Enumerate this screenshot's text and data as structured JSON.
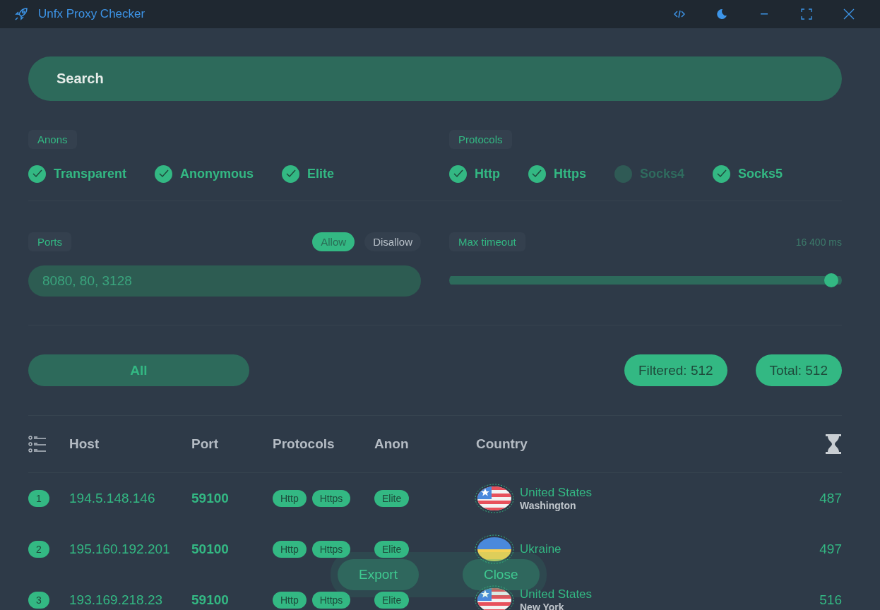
{
  "window": {
    "title": "Unfx Proxy Checker"
  },
  "search": {
    "placeholder": "Search"
  },
  "anons": {
    "label": "Anons",
    "items": [
      {
        "label": "Transparent",
        "checked": true
      },
      {
        "label": "Anonymous",
        "checked": true
      },
      {
        "label": "Elite",
        "checked": true
      }
    ]
  },
  "protocols": {
    "label": "Protocols",
    "items": [
      {
        "label": "Http",
        "checked": true
      },
      {
        "label": "Https",
        "checked": true
      },
      {
        "label": "Socks4",
        "checked": false
      },
      {
        "label": "Socks5",
        "checked": true
      }
    ]
  },
  "ports": {
    "label": "Ports",
    "modes": [
      {
        "label": "Allow",
        "selected": true
      },
      {
        "label": "Disallow",
        "selected": false
      }
    ],
    "placeholder": "8080, 80, 3128"
  },
  "timeout": {
    "label": "Max timeout",
    "reading": "16 400 ms",
    "level": 0.99
  },
  "summary": {
    "filter_button": "All",
    "filtered": "Filtered: 512",
    "total": "Total: 512"
  },
  "table": {
    "columns": [
      "Host",
      "Port",
      "Protocols",
      "Anon",
      "Country"
    ],
    "rows": [
      {
        "number": "1",
        "host": "194.5.148.146",
        "port": "59100",
        "protocols": [
          "Http",
          "Https"
        ],
        "anon": "Elite",
        "flag": {
          "kind": "us"
        },
        "country": "United States",
        "city": "Washington",
        "time": "487"
      },
      {
        "number": "2",
        "host": "195.160.192.201",
        "port": "50100",
        "protocols": [
          "Http",
          "Https"
        ],
        "anon": "Elite",
        "flag": {
          "kind": "ua"
        },
        "country": "Ukraine",
        "time": "497"
      },
      {
        "number": "3",
        "host": "193.169.218.23",
        "port": "59100",
        "protocols": [
          "Http",
          "Https"
        ],
        "anon": "Elite",
        "flag": {
          "kind": "us"
        },
        "country": "United States",
        "city": "New York",
        "time": "516"
      }
    ]
  },
  "actions": [
    "Export",
    "Close"
  ]
}
